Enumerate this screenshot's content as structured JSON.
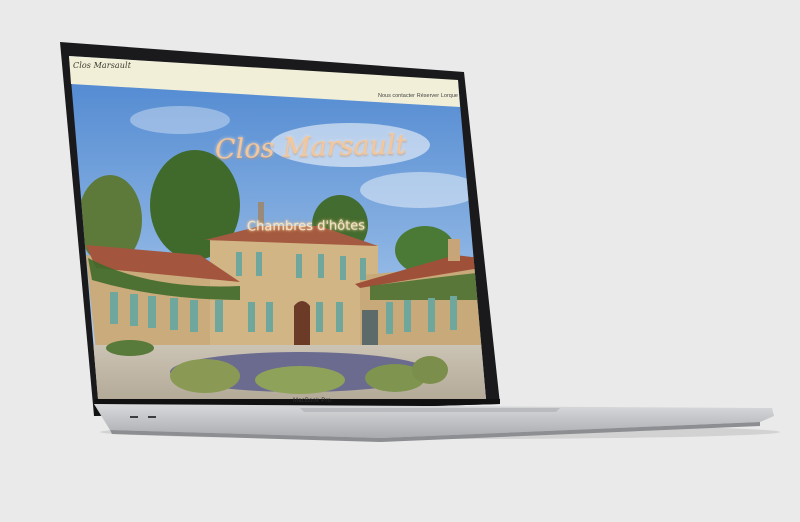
{
  "site": {
    "title": "Clos Marsault",
    "nav": [
      "Nous contacter",
      "Réserver",
      "Lorque"
    ]
  },
  "hero": {
    "title": "Clos Marsault",
    "subtitle": "Chambres d'hôtes"
  },
  "device": {
    "label": "MacBook Pro"
  },
  "colors": {
    "background": "#eaeaea",
    "nav_bar": "#f2efd9",
    "hero_title": "#f4c69a",
    "sky": "#4a84cf",
    "shutters": "#6fa79d"
  }
}
